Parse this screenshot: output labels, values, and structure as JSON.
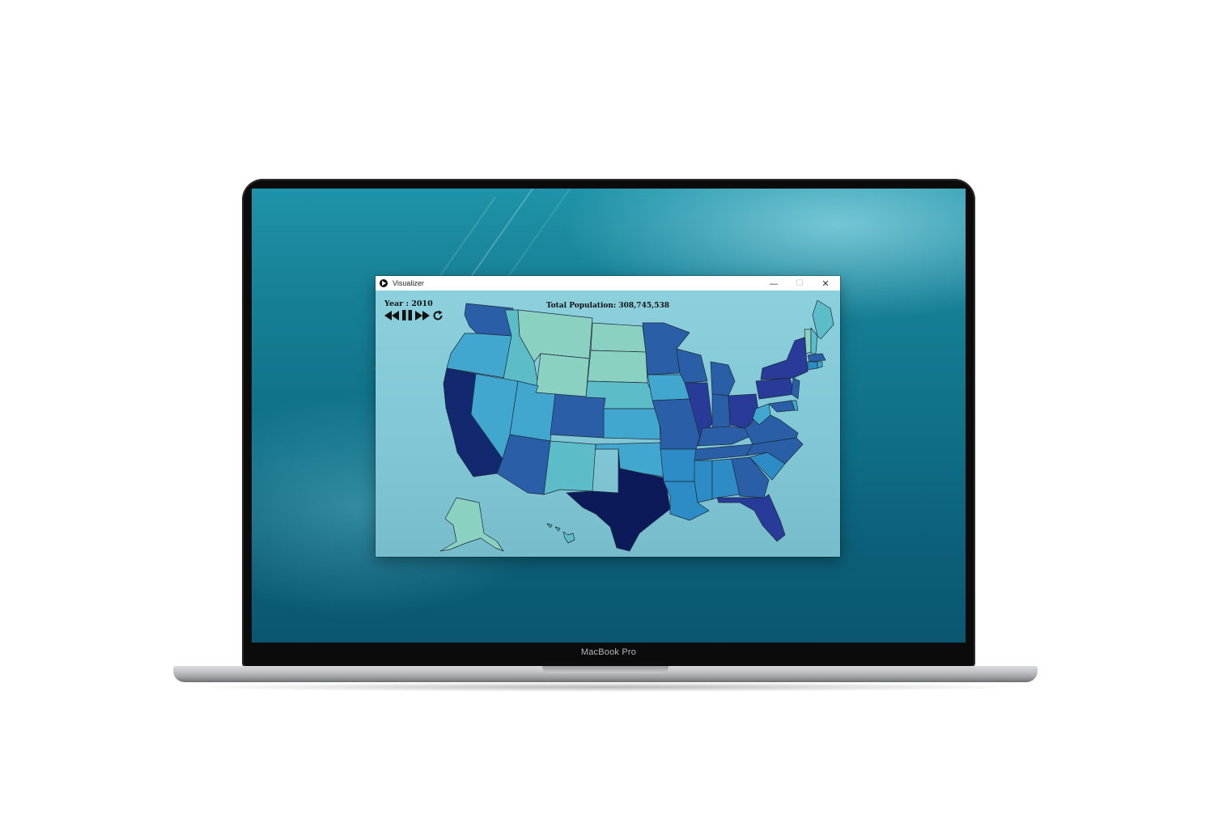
{
  "device": {
    "label": "MacBook Pro"
  },
  "window": {
    "title": "Visualizer",
    "minimize_glyph": "—",
    "maximize_glyph": "☐",
    "close_glyph": "✕"
  },
  "visualizer": {
    "year_label": "Year : 2010",
    "total_label": "Total Population: 308,745,538",
    "controls": [
      "rewind-icon",
      "pause-icon",
      "fast-forward-icon",
      "refresh-icon"
    ]
  },
  "colors": {
    "lightest": "#8ad1c2",
    "light": "#5cbdc9",
    "mid_light": "#41a7cf",
    "mid": "#2d8bc5",
    "mid_dark": "#2a5fa8",
    "dark": "#283b98",
    "darkest": "#13296f",
    "deepest": "#0c1a5a"
  }
}
